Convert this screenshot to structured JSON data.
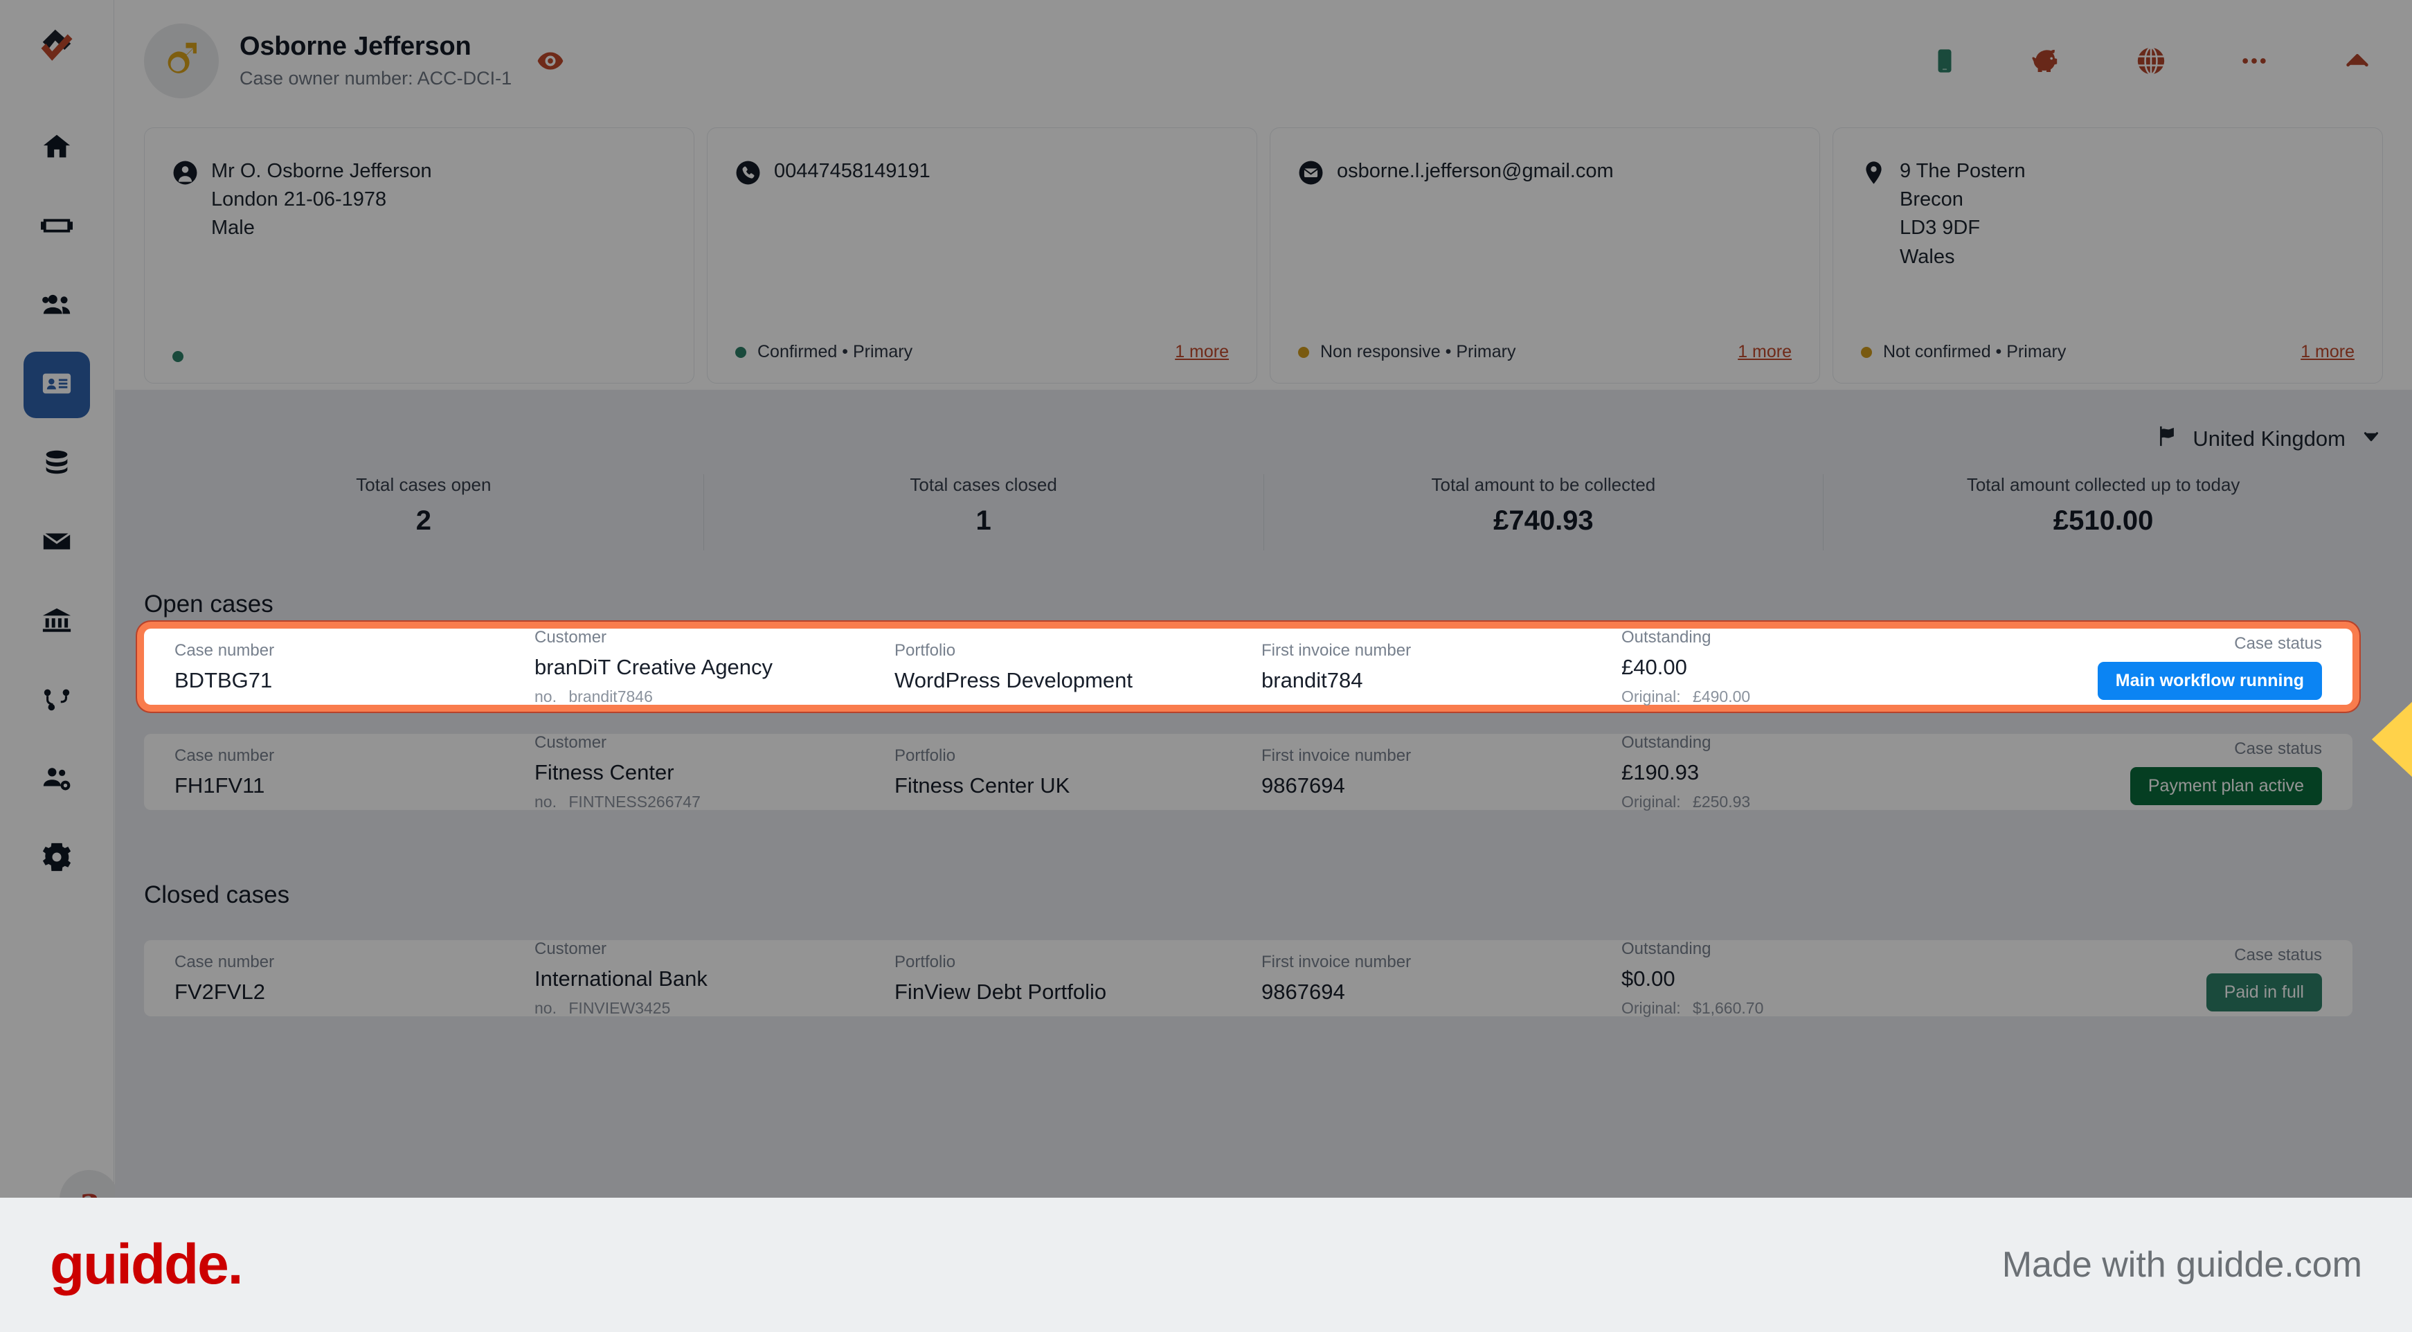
{
  "sidebar": {
    "logo_name": "finview-logo",
    "items": [
      {
        "name": "home",
        "icon": "home-icon",
        "active": false
      },
      {
        "name": "cards",
        "icon": "card-icon",
        "active": false
      },
      {
        "name": "customers",
        "icon": "people-icon",
        "active": false
      },
      {
        "name": "contacts",
        "icon": "contact-card-icon",
        "active": true
      },
      {
        "name": "data",
        "icon": "database-icon",
        "active": false
      },
      {
        "name": "mail",
        "icon": "envelope-icon",
        "active": false
      },
      {
        "name": "banks",
        "icon": "bank-icon",
        "active": false
      },
      {
        "name": "workflows",
        "icon": "workflow-icon",
        "active": false
      },
      {
        "name": "teams",
        "icon": "people-gear-icon",
        "active": false
      },
      {
        "name": "settings",
        "icon": "gear-icon",
        "active": false
      }
    ],
    "bottom_avatar_initial": "a"
  },
  "header": {
    "avatar_icon": "male-gender-icon",
    "name": "Osborne Jefferson",
    "case_owner": "Case owner number: ACC-DCI-1",
    "eye_icon": "eye-icon",
    "actions": [
      {
        "name": "mobile-phone-icon",
        "color": "#2e8068"
      },
      {
        "name": "piggy-bank-icon",
        "color": "#b4452b"
      },
      {
        "name": "globe-icon",
        "color": "#b4452b"
      },
      {
        "name": "more-options-icon",
        "color": "#b4452b"
      },
      {
        "name": "collapse-chevron-up-icon",
        "color": "#b4452b"
      }
    ]
  },
  "contact_cards": [
    {
      "icon": "person-icon",
      "lines": [
        "Mr O. Osborne Jefferson",
        "London 21-06-1978",
        "Male"
      ],
      "status_dot_color": "#2e8068",
      "status": "",
      "more": ""
    },
    {
      "icon": "phone-icon",
      "lines": [
        "00447458149191"
      ],
      "status_dot_color": "#2e8068",
      "status": "Confirmed • Primary",
      "more": "1 more"
    },
    {
      "icon": "email-icon",
      "lines": [
        "osborne.l.jefferson@gmail.com"
      ],
      "status_dot_color": "#d09c1c",
      "status": "Non responsive • Primary",
      "more": "1 more"
    },
    {
      "icon": "location-pin-icon",
      "lines": [
        "9 The Postern",
        "Brecon",
        "LD3 9DF",
        "Wales"
      ],
      "status_dot_color": "#d09c1c",
      "status": "Not confirmed • Primary",
      "more": "1 more"
    }
  ],
  "country_selector": {
    "flag_icon": "flag-icon",
    "label": "United Kingdom",
    "chevron_icon": "chevron-down-icon"
  },
  "stats": [
    {
      "label": "Total cases open",
      "value": "2"
    },
    {
      "label": "Total cases closed",
      "value": "1"
    },
    {
      "label": "Total amount to be collected",
      "value": "£740.93"
    },
    {
      "label": "Total amount collected up to today",
      "value": "£510.00"
    }
  ],
  "sections": {
    "open_title": "Open cases",
    "closed_title": "Closed cases"
  },
  "column_labels": {
    "case_number": "Case number",
    "customer": "Customer",
    "portfolio": "Portfolio",
    "first_invoice": "First invoice number",
    "outstanding": "Outstanding",
    "case_status": "Case status",
    "customer_no_prefix": "no.",
    "original_prefix": "Original:"
  },
  "open_cases": [
    {
      "case_number": "BDTBG71",
      "customer": "branDiT Creative Agency",
      "customer_no": "brandit7846",
      "portfolio": "WordPress Development",
      "first_invoice": "brandit784",
      "outstanding": "£40.00",
      "original": "£490.00",
      "status": "Main workflow running",
      "status_color": "#0b84f3",
      "highlighted": true
    },
    {
      "case_number": "FH1FV11",
      "customer": "Fitness Center",
      "customer_no": "FINTNESS266747",
      "portfolio": "Fitness Center UK",
      "first_invoice": "9867694",
      "outstanding": "£190.93",
      "original": "£250.93",
      "status": "Payment plan active",
      "status_color": "#0a6c3b",
      "highlighted": false
    }
  ],
  "closed_cases": [
    {
      "case_number": "FV2FVL2",
      "customer": "International Bank",
      "customer_no": "FINVIEW3425",
      "portfolio": "FinView Debt Portfolio",
      "first_invoice": "9867694",
      "outstanding": "$0.00",
      "original": "$1,660.70",
      "status": "Paid in full",
      "status_color": "#2e8068",
      "highlighted": false
    }
  ],
  "footer": {
    "logo_text": "guidde.",
    "made_with": "Made with guidde.com"
  }
}
